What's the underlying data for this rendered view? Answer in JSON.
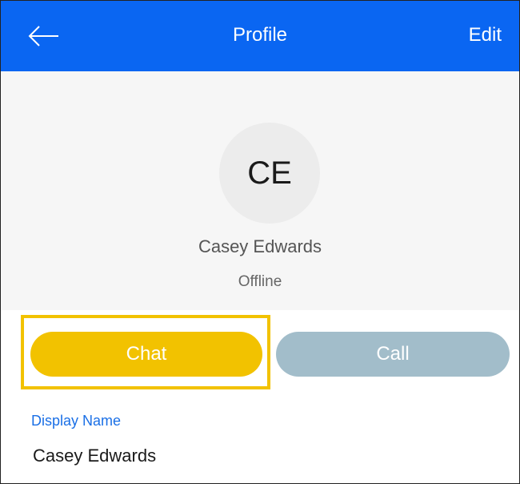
{
  "header": {
    "back_icon": "arrow-left-icon",
    "title": "Profile",
    "edit_label": "Edit",
    "background": "#0a66f2"
  },
  "profile": {
    "initials": "CE",
    "name": "Casey Edwards",
    "status": "Offline"
  },
  "actions": {
    "chat_label": "Chat",
    "call_label": "Call",
    "chat_color": "#f2c200",
    "call_color": "#a2bdca",
    "highlight_color": "#f2c200"
  },
  "details": {
    "display_name_label": "Display Name",
    "display_name_value": "Casey Edwards"
  }
}
